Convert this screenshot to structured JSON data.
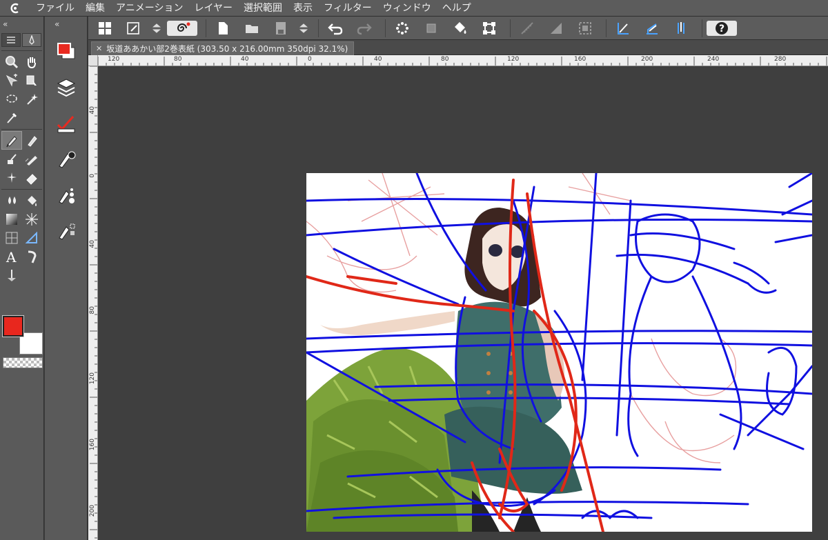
{
  "menu": {
    "items": [
      "ファイル",
      "編集",
      "アニメーション",
      "レイヤー",
      "選択範囲",
      "表示",
      "フィルター",
      "ウィンドウ",
      "ヘルプ"
    ]
  },
  "document": {
    "tab_title": "坂道ああかい部2巻表紙 (303.50 x 216.00mm 350dpi 32.1%)"
  },
  "ruler": {
    "top_labels": [
      "120",
      "80",
      "40",
      "0",
      "40",
      "80",
      "120",
      "160",
      "200",
      "240",
      "280"
    ],
    "left_labels": [
      "40",
      "0",
      "40",
      "80",
      "120",
      "160",
      "200"
    ]
  },
  "colors": {
    "main": "#e8271e",
    "sub": "#ffffff",
    "sketch_blue": "#1010e0",
    "sketch_red": "#e02818",
    "sketch_pink": "#e8a0a0",
    "uniform": "#3f6e6a",
    "tree": "#7da33a"
  },
  "icons": {
    "toolbar": [
      "grid-icon",
      "brush-settings-icon",
      "up-down-arrows-icon",
      "spiral-icon",
      "new-file-icon",
      "open-folder-icon",
      "save-icon",
      "up-down-arrows-icon",
      "undo-icon",
      "redo-icon",
      "dots-icon",
      "transform-icon",
      "fill-bucket-icon",
      "transform-handles-icon",
      "ruler-off-icon",
      "gradient-icon",
      "selection-icon",
      "snap-ruler-icon",
      "snap-grid-icon",
      "snap-special-icon",
      "help-icon"
    ]
  }
}
